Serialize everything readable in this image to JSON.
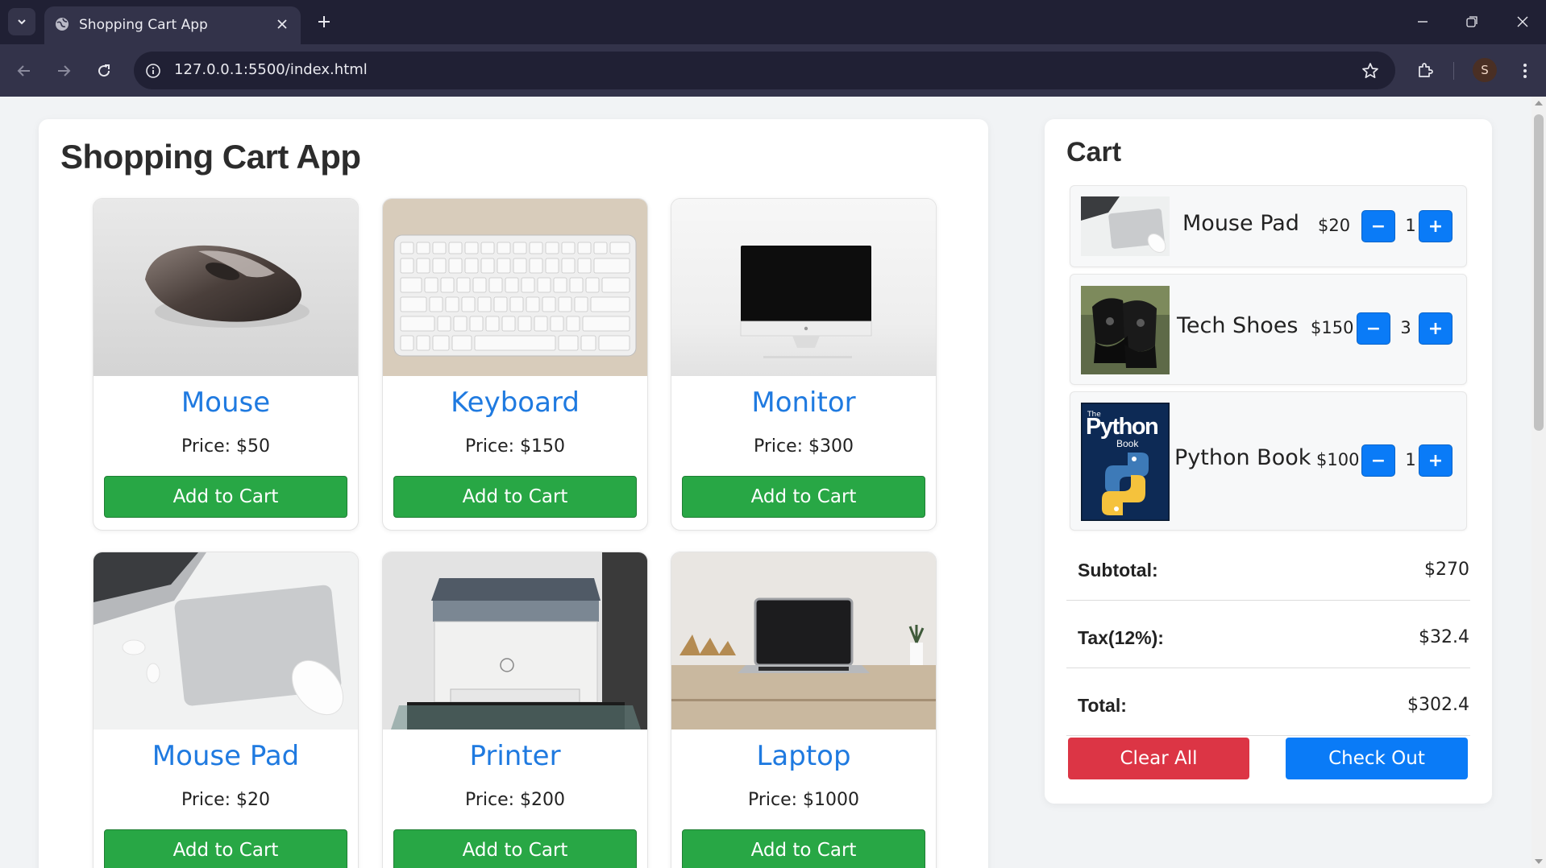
{
  "browser": {
    "tab_title": "Shopping Cart App",
    "url": "127.0.0.1:5500/index.html",
    "profile_initial": "S",
    "icons": [
      "tab-search-icon",
      "globe-icon",
      "close-icon",
      "plus-icon",
      "minimize-icon",
      "restore-icon",
      "window-close-icon",
      "back-icon",
      "forward-icon",
      "reload-icon",
      "info-icon",
      "star-icon",
      "extensions-icon",
      "menu-icon"
    ]
  },
  "page": {
    "title": "Shopping Cart App"
  },
  "products": [
    {
      "name": "Mouse",
      "price": "Price: $50",
      "button": "Add to Cart"
    },
    {
      "name": "Keyboard",
      "price": "Price: $150",
      "button": "Add to Cart"
    },
    {
      "name": "Monitor",
      "price": "Price: $300",
      "button": "Add to Cart"
    },
    {
      "name": "Mouse Pad",
      "price": "Price: $20",
      "button": "Add to Cart"
    },
    {
      "name": "Printer",
      "price": "Price: $200",
      "button": "Add to Cart"
    },
    {
      "name": "Laptop",
      "price": "Price: $1000",
      "button": "Add to Cart"
    }
  ],
  "cart": {
    "title": "Cart",
    "items": [
      {
        "name": "Mouse Pad",
        "price": "$20",
        "qty": "1",
        "minus": "−",
        "plus": "+"
      },
      {
        "name": "Tech Shoes",
        "price": "$150",
        "qty": "3",
        "minus": "−",
        "plus": "+"
      },
      {
        "name": "Python Book",
        "price": "$100",
        "qty": "1",
        "minus": "−",
        "plus": "+",
        "cover_top": "Python",
        "cover_small": "The",
        "cover_sub": "Book"
      }
    ],
    "subtotal_label": "Subtotal:",
    "subtotal": "$270",
    "tax_label": "Tax(12%):",
    "tax": "$32.4",
    "total_label": "Total:",
    "total": "$302.4",
    "clear_label": "Clear All",
    "checkout_label": "Check Out"
  },
  "colors": {
    "accent_blue": "#0a7bf7",
    "product_name": "#1f7ae0",
    "add_green": "#28a745",
    "clear_red": "#dc3545"
  }
}
